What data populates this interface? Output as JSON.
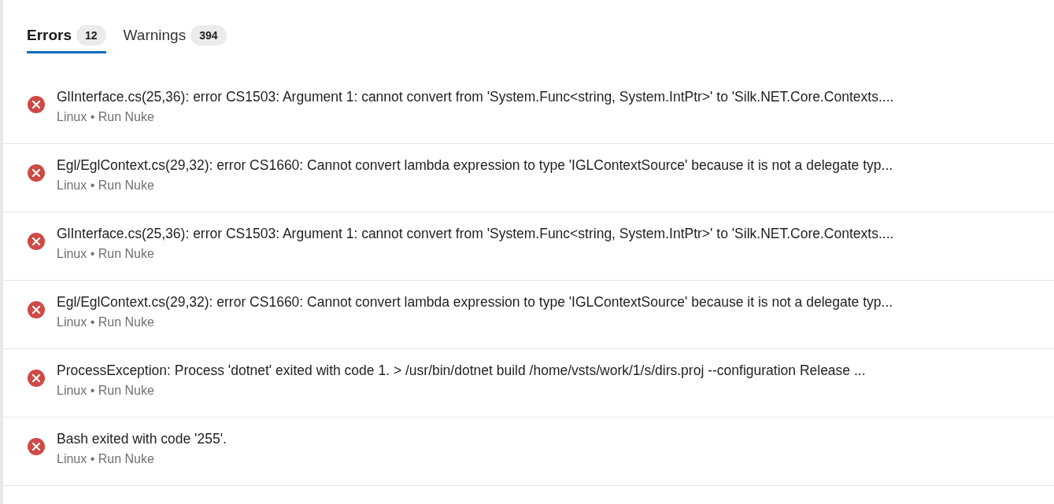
{
  "tabs": [
    {
      "label": "Errors",
      "count": "12",
      "selected": true
    },
    {
      "label": "Warnings",
      "count": "394",
      "selected": false
    }
  ],
  "issues": [
    {
      "kind": "error",
      "message": "GlInterface.cs(25,36): error CS1503: Argument 1: cannot convert from 'System.Func<string, System.IntPtr>' to 'Silk.NET.Core.Contexts....",
      "source": "Linux • Run Nuke"
    },
    {
      "kind": "error",
      "message": "Egl/EglContext.cs(29,32): error CS1660: Cannot convert lambda expression to type 'IGLContextSource' because it is not a delegate typ...",
      "source": "Linux • Run Nuke"
    },
    {
      "kind": "error",
      "message": "GlInterface.cs(25,36): error CS1503: Argument 1: cannot convert from 'System.Func<string, System.IntPtr>' to 'Silk.NET.Core.Contexts....",
      "source": "Linux • Run Nuke"
    },
    {
      "kind": "error",
      "message": "Egl/EglContext.cs(29,32): error CS1660: Cannot convert lambda expression to type 'IGLContextSource' because it is not a delegate typ...",
      "source": "Linux • Run Nuke"
    },
    {
      "kind": "error",
      "message": "ProcessException: Process 'dotnet' exited with code 1. > /usr/bin/dotnet build /home/vsts/work/1/s/dirs.proj --configuration Release ...",
      "source": "Linux • Run Nuke"
    },
    {
      "kind": "error",
      "message": "Bash exited with code '255'.",
      "source": "Linux • Run Nuke"
    }
  ]
}
